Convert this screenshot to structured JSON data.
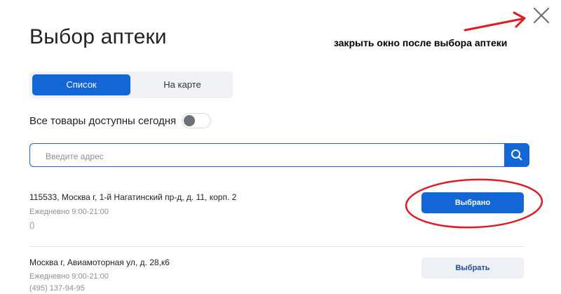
{
  "modal": {
    "title": "Выбор аптеки",
    "close_icon": "close-icon",
    "annotation": "закрыть окно после выбора аптеки"
  },
  "tabs": [
    {
      "label": "Список",
      "active": true
    },
    {
      "label": "На карте",
      "active": false
    }
  ],
  "filter": {
    "label": "Все товары доступны сегодня",
    "enabled": false
  },
  "search": {
    "placeholder": "Введите адрес",
    "value": "",
    "icon": "search-icon"
  },
  "pharmacies": [
    {
      "address": "115533, Москва г, 1-й Нагатинский пр-д, д. 11, корп. 2",
      "hours": "Ежедневно 9:00-21:00",
      "phone": "()",
      "button_label": "Выбрано",
      "selected": true
    },
    {
      "address": "Москва г, Авиамоторная ул, д. 28,к6",
      "hours": "Ежедневно 9:00-21:00",
      "phone": "(495) 137-94-95",
      "button_label": "Выбрать",
      "selected": false
    }
  ],
  "colors": {
    "accent": "#1266d6",
    "annotation_red": "#e01b24"
  }
}
